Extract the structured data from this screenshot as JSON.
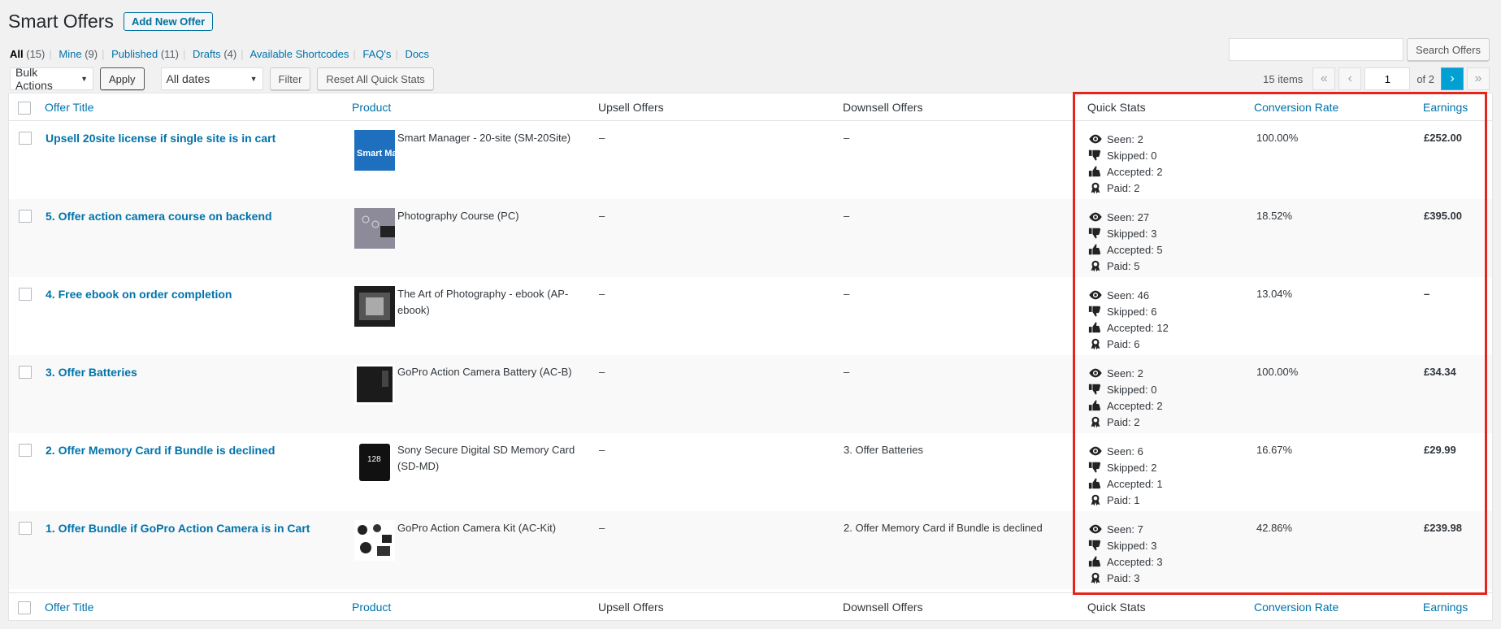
{
  "header": {
    "title": "Smart Offers",
    "add_new_label": "Add New Offer"
  },
  "views": [
    {
      "label": "All",
      "count": "(15)"
    },
    {
      "label": "Mine",
      "count": "(9)"
    },
    {
      "label": "Published",
      "count": "(11)"
    },
    {
      "label": "Drafts",
      "count": "(4)"
    },
    {
      "label": "Available Shortcodes",
      "count": ""
    },
    {
      "label": "FAQ's",
      "count": ""
    },
    {
      "label": "Docs",
      "count": ""
    }
  ],
  "search": {
    "button_label": "Search Offers",
    "value": ""
  },
  "toolbar": {
    "bulk_actions": "Bulk Actions",
    "apply_label": "Apply",
    "dates": "All dates",
    "filter_label": "Filter",
    "reset_label": "Reset All Quick Stats"
  },
  "pagination": {
    "items_text": "15 items",
    "first": "«",
    "prev": "‹",
    "next": "›",
    "last": "»",
    "current_page": "1",
    "of_text": "of 2"
  },
  "columns": {
    "title": "Offer Title",
    "product": "Product",
    "upsell": "Upsell Offers",
    "downsell": "Downsell Offers",
    "quick_stats": "Quick Stats",
    "conversion": "Conversion Rate",
    "earnings": "Earnings"
  },
  "rows": [
    {
      "title": "Upsell 20site license if single site is in cart",
      "product_name": "Smart Manager - 20-site (SM-20Site)",
      "thumb_text": "Smart Manager",
      "upsell": "–",
      "downsell": "–",
      "seen": "Seen: 2",
      "skipped": "Skipped: 0",
      "accepted": "Accepted: 2",
      "paid": "Paid: 2",
      "conversion": "100.00%",
      "earnings": "£252.00"
    },
    {
      "title": "5. Offer action camera course on backend",
      "product_name": "Photography Course (PC)",
      "thumb_text": "",
      "upsell": "–",
      "downsell": "–",
      "seen": "Seen: 27",
      "skipped": "Skipped: 3",
      "accepted": "Accepted: 5",
      "paid": "Paid: 5",
      "conversion": "18.52%",
      "earnings": "£395.00"
    },
    {
      "title": "4. Free ebook on order completion",
      "product_name": "The Art of Photography - ebook (AP-ebook)",
      "thumb_text": "",
      "upsell": "–",
      "downsell": "–",
      "seen": "Seen: 46",
      "skipped": "Skipped: 6",
      "accepted": "Accepted: 12",
      "paid": "Paid: 6",
      "conversion": "13.04%",
      "earnings": "–"
    },
    {
      "title": "3. Offer Batteries",
      "product_name": "GoPro Action Camera Battery (AC-B)",
      "thumb_text": "",
      "upsell": "–",
      "downsell": "–",
      "seen": "Seen: 2",
      "skipped": "Skipped: 0",
      "accepted": "Accepted: 2",
      "paid": "Paid: 2",
      "conversion": "100.00%",
      "earnings": "£34.34"
    },
    {
      "title": "2. Offer Memory Card if Bundle is declined",
      "product_name": "Sony Secure Digital SD Memory Card (SD-MD)",
      "thumb_text": "128",
      "upsell": "–",
      "downsell": "3. Offer Batteries",
      "seen": "Seen: 6",
      "skipped": "Skipped: 2",
      "accepted": "Accepted: 1",
      "paid": "Paid: 1",
      "conversion": "16.67%",
      "earnings": "£29.99"
    },
    {
      "title": "1. Offer Bundle if GoPro Action Camera is in Cart",
      "product_name": "GoPro Action Camera Kit (AC-Kit)",
      "thumb_text": "",
      "upsell": "–",
      "downsell": "2. Offer Memory Card if Bundle is declined",
      "seen": "Seen: 7",
      "skipped": "Skipped: 3",
      "accepted": "Accepted: 3",
      "paid": "Paid: 3",
      "conversion": "42.86%",
      "earnings": "£239.98"
    }
  ],
  "colors": {
    "link": "#0073aa",
    "highlight": "#e3261c",
    "active_page": "#00a0d2"
  }
}
